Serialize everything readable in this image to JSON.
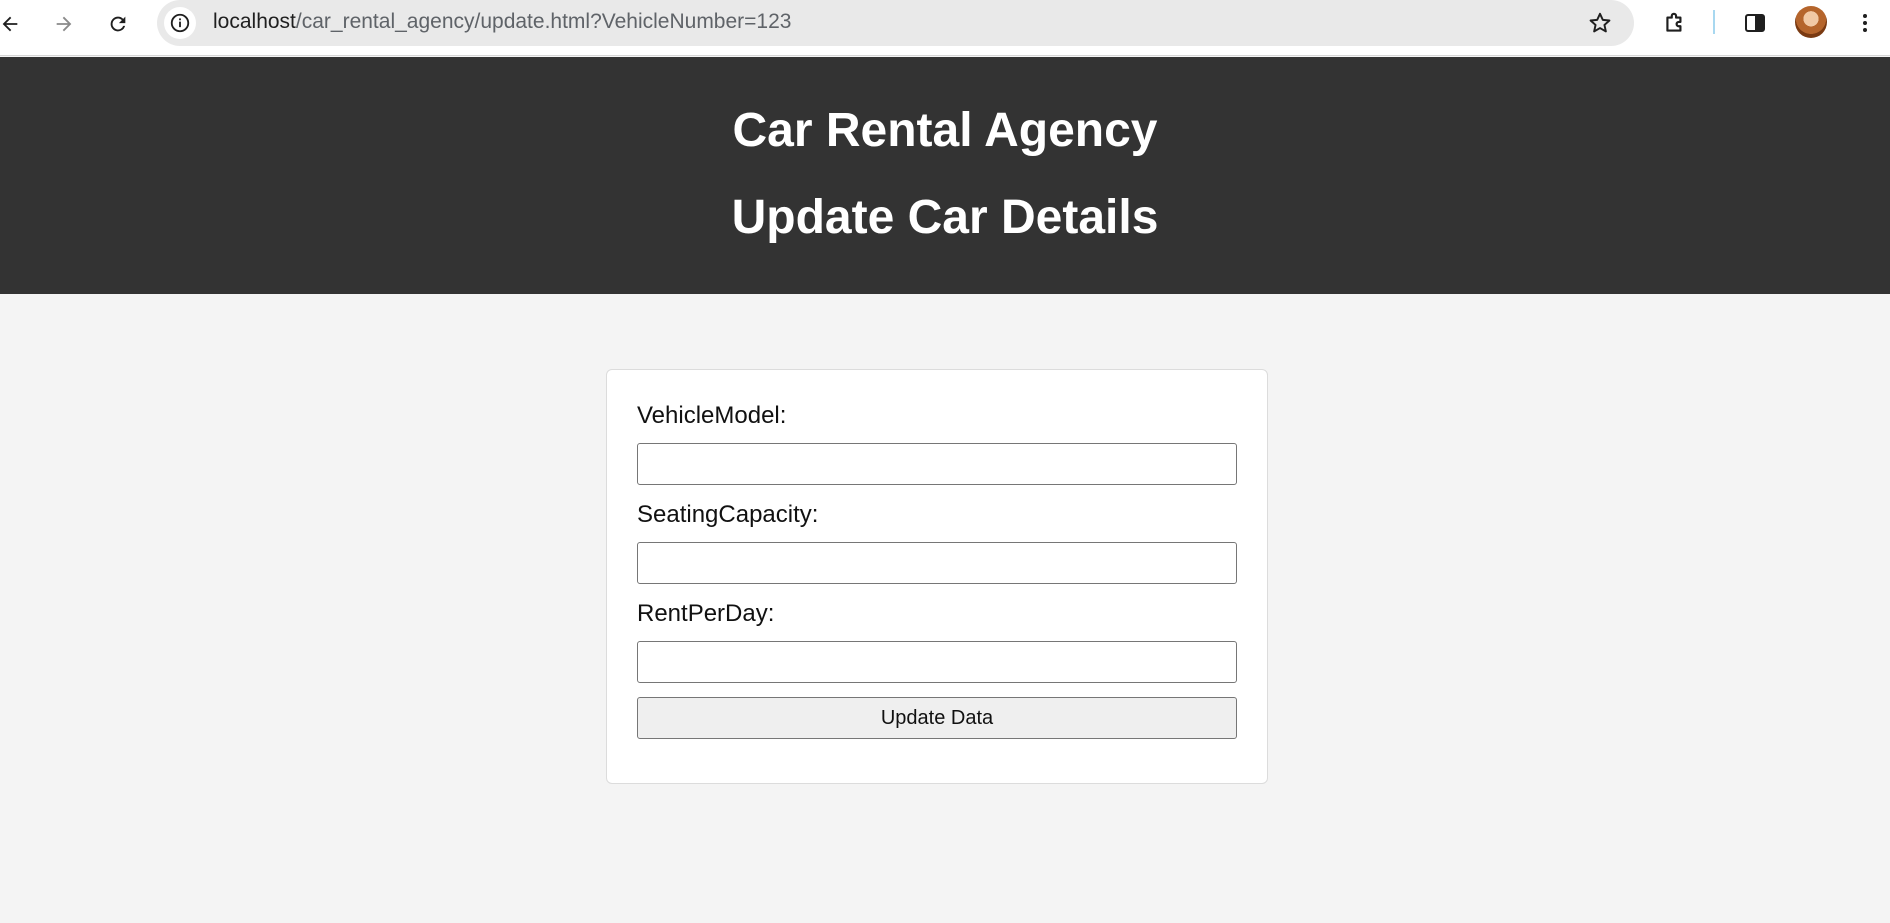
{
  "browser": {
    "url_host": "localhost",
    "url_path": "/car_rental_agency/update.html?VehicleNumber=123"
  },
  "header": {
    "title": "Car Rental Agency",
    "subtitle": "Update Car Details"
  },
  "form": {
    "fields": [
      {
        "label": "VehicleModel:",
        "value": ""
      },
      {
        "label": "SeatingCapacity:",
        "value": ""
      },
      {
        "label": "RentPerDay:",
        "value": ""
      }
    ],
    "submit_label": "Update Data"
  },
  "colors": {
    "header_bg": "#333333",
    "page_bg": "#f4f4f4"
  },
  "icons": [
    "back-icon",
    "forward-icon",
    "reload-icon",
    "site-info-icon",
    "bookmark-star-icon",
    "extensions-icon",
    "side-panel-icon",
    "profile-avatar"
  ]
}
